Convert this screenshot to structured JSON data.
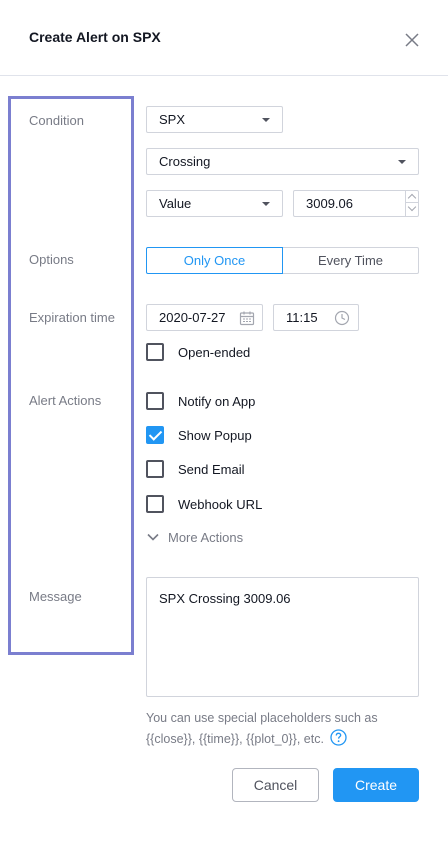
{
  "dialog": {
    "title": "Create Alert on SPX"
  },
  "labels": {
    "condition": "Condition",
    "options": "Options",
    "expiration": "Expiration time",
    "alert_actions": "Alert Actions",
    "message": "Message"
  },
  "condition": {
    "symbol": "SPX",
    "operator": "Crossing",
    "target_type": "Value",
    "target_value": "3009.06"
  },
  "options": {
    "once": "Only Once",
    "every": "Every Time",
    "selected": "Only Once"
  },
  "expiration": {
    "date": "2020-07-27",
    "time": "11:15",
    "open_ended_label": "Open-ended",
    "open_ended_checked": false
  },
  "actions": {
    "notify_app": {
      "label": "Notify on App",
      "checked": false
    },
    "show_popup": {
      "label": "Show Popup",
      "checked": true
    },
    "send_email": {
      "label": "Send Email",
      "checked": false
    },
    "webhook": {
      "label": "Webhook URL",
      "checked": false
    },
    "more": "More Actions"
  },
  "message": {
    "text": "SPX Crossing 3009.06",
    "hint": "You can use special placeholders such as {{close}}, {{time}}, {{plot_0}}, etc."
  },
  "buttons": {
    "cancel": "Cancel",
    "create": "Create"
  },
  "colors": {
    "accent": "#2196f3",
    "highlight_frame": "#7b7fd0",
    "muted_text": "#787b86"
  }
}
